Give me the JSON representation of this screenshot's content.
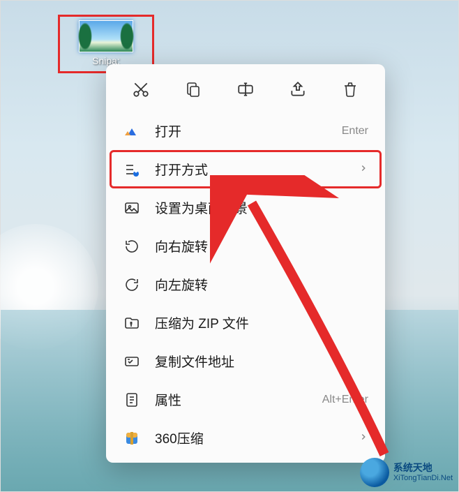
{
  "desktop": {
    "icon_label": "Snipa:"
  },
  "toolbar": {
    "cut": "cut",
    "copy": "copy",
    "rename": "rename",
    "share": "share",
    "delete": "delete"
  },
  "menu": {
    "open": {
      "label": "打开",
      "shortcut": "Enter"
    },
    "open_with": {
      "label": "打开方式"
    },
    "set_wallpaper": {
      "label": "设置为桌面背景"
    },
    "rotate_right": {
      "label": "向右旋转"
    },
    "rotate_left": {
      "label": "向左旋转"
    },
    "compress_zip": {
      "label": "压缩为 ZIP 文件"
    },
    "copy_path": {
      "label": "复制文件地址"
    },
    "properties": {
      "label": "属性",
      "shortcut": "Alt+Enter"
    },
    "compress_360": {
      "label": "360压缩"
    }
  },
  "watermark": {
    "title": "系统天地",
    "subtitle": "XiTongTianDi.Net"
  },
  "annotations": {
    "highlight_color": "#e52a2a"
  }
}
